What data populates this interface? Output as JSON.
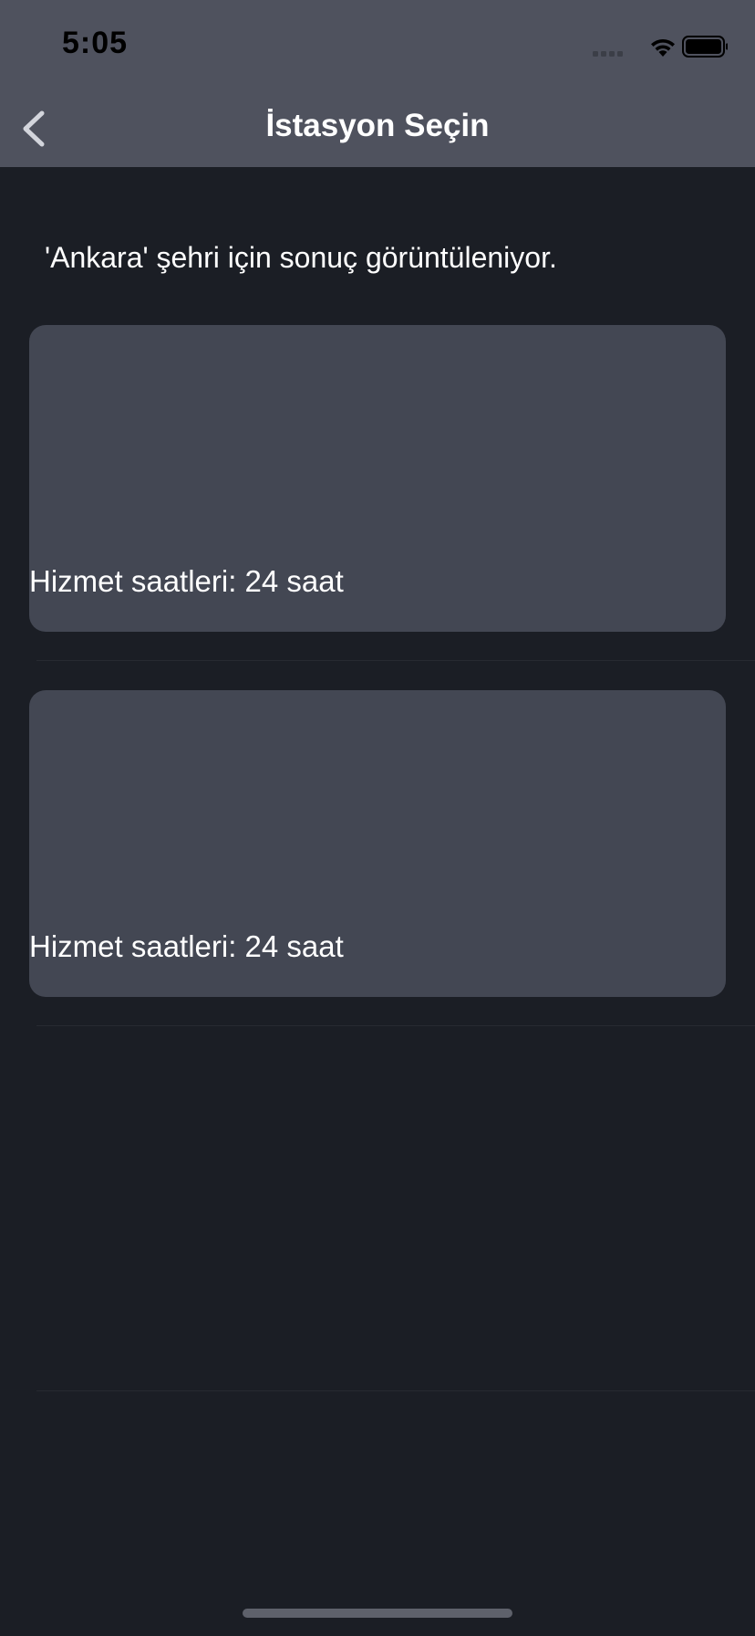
{
  "status_bar": {
    "time": "5:05",
    "icons": [
      "cellular-signal-icon",
      "wifi-icon",
      "battery-icon"
    ]
  },
  "nav": {
    "back_icon": "chevron-left-icon",
    "title": "İstasyon Seçin"
  },
  "result_info": "'Ankara' şehri için sonuç görüntüleniyor.",
  "stations": [
    {
      "hours": "Hizmet saatleri: 24 saat"
    },
    {
      "hours": "Hizmet saatleri: 24 saat"
    }
  ],
  "colors": {
    "header_bg": "#4f525e",
    "page_bg": "#1b1e25",
    "card_bg": "#434753",
    "text": "#ffffff"
  }
}
